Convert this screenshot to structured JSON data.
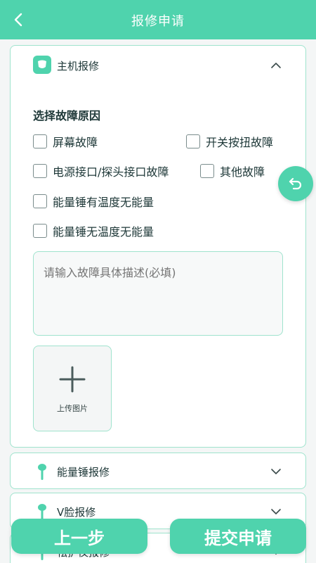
{
  "header": {
    "title": "报修申请"
  },
  "main_section": {
    "title": "主机报修",
    "subhead": "选择故障原因",
    "options": [
      {
        "label": "屏幕故障"
      },
      {
        "label": "开关按扭故障"
      },
      {
        "label": "电源接口/探头接口故障"
      },
      {
        "label": "其他故障"
      },
      {
        "label": "能量锤有温度无能量"
      },
      {
        "label": "能量锤无温度无能量"
      }
    ],
    "description_placeholder": "请输入故障具体描述(必填)",
    "upload_label": "上传图片"
  },
  "sections": [
    {
      "title": "能量锤报修"
    },
    {
      "title": "V脸报修"
    },
    {
      "title": "祛护仪报修"
    }
  ],
  "footer": {
    "prev_label": "上一步",
    "submit_label": "提交申请"
  },
  "colors": {
    "accent": "#4fd3ad",
    "border": "#9fe3cd",
    "background": "#f4f6f6"
  }
}
